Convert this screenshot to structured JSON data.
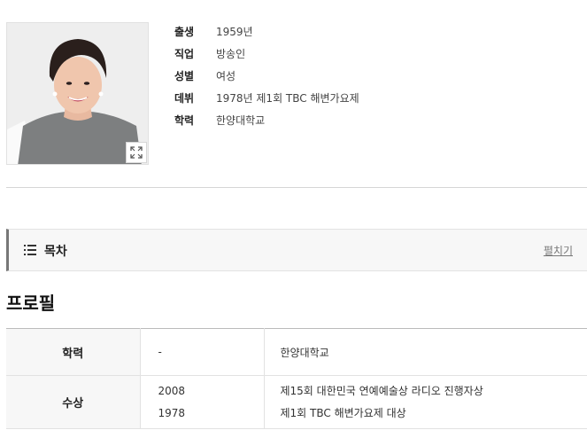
{
  "profile": {
    "photo_alt": "",
    "expand_icon": "expand-icon",
    "info": [
      {
        "label": "출생",
        "value": "1959년"
      },
      {
        "label": "직업",
        "value": "방송인"
      },
      {
        "label": "성별",
        "value": "여성"
      },
      {
        "label": "데뷔",
        "value": "1978년 제1회 TBC 해변가요제"
      },
      {
        "label": "학력",
        "value": "한양대학교"
      }
    ]
  },
  "toc": {
    "icon": "list-icon",
    "title": "목차",
    "toggle_label": "펼치기"
  },
  "section": {
    "title": "프로필"
  },
  "table": {
    "education": {
      "header": "학력",
      "year": "-",
      "desc": "한양대학교"
    },
    "awards": {
      "header": "수상",
      "items": [
        {
          "year": "2008",
          "desc": "제15회 대한민국 연예예술상 라디오 진행자상"
        },
        {
          "year": "1978",
          "desc": "제1회 TBC 해변가요제 대상"
        }
      ]
    }
  },
  "colors": {
    "toc_accent": "#777777",
    "table_header_bg": "#f7f7f7",
    "divider": "#d6d6d6"
  }
}
